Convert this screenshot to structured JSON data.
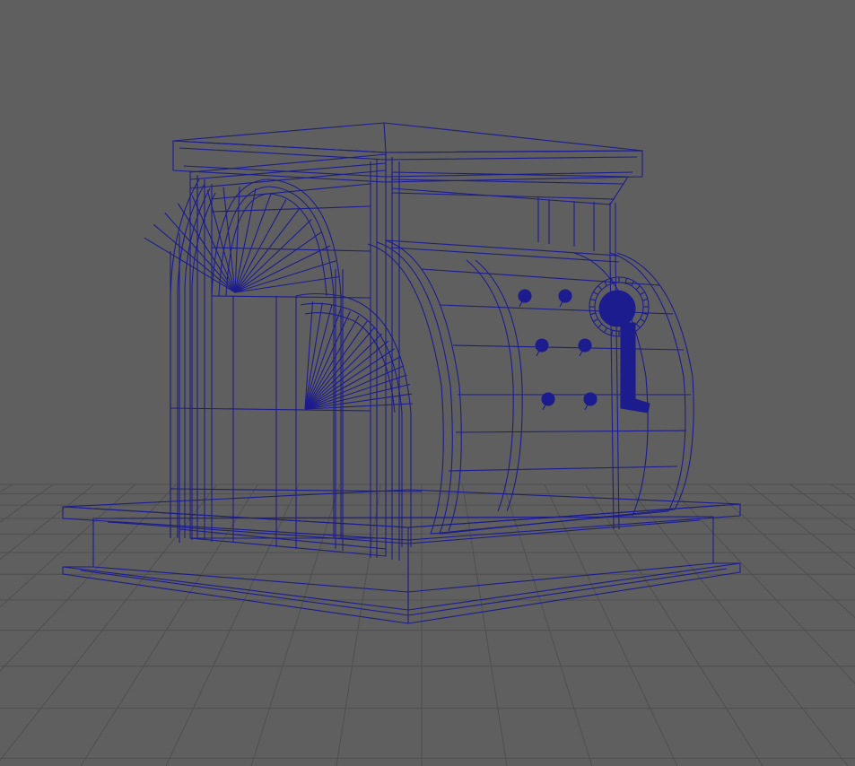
{
  "viewport": {
    "mode": "wireframe",
    "background_color": "#5f5f5f",
    "grid_visible": true,
    "grid_color": "#4f4f4f",
    "wireframe_color": "#1c1c8e",
    "icons": [
      "ground-grid-icon",
      "vault-wireframe-icon",
      "lock-dial-icon",
      "vault-handle-icon"
    ]
  }
}
